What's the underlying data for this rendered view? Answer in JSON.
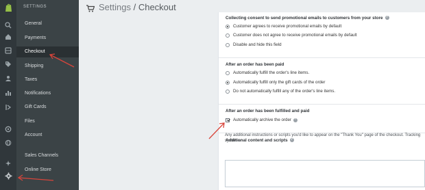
{
  "rail": {
    "icons": [
      "shopify-logo-icon",
      "search-icon",
      "home-icon",
      "orders-icon",
      "products-icon",
      "tag-icon",
      "customers-icon",
      "reports-icon",
      "discounts-icon",
      "apps-icon",
      "online-store-icon",
      "globe-icon",
      "settings-icon"
    ]
  },
  "sidebar": {
    "heading": "SETTINGS",
    "items": [
      {
        "label": "General"
      },
      {
        "label": "Payments"
      },
      {
        "label": "Checkout"
      },
      {
        "label": "Shipping"
      },
      {
        "label": "Taxes"
      },
      {
        "label": "Notifications"
      },
      {
        "label": "Gift Cards"
      },
      {
        "label": "Files"
      },
      {
        "label": "Account"
      },
      {
        "label": "Sales Channels"
      },
      {
        "label": "Online Store"
      }
    ]
  },
  "header": {
    "crumb": "Settings",
    "separator": " / ",
    "page": "Checkout"
  },
  "consent": {
    "title": "Collecting consent to send promotional emails to customers from your store",
    "options": [
      {
        "label": "Customer agrees to receive promotional emails by default",
        "selected": true
      },
      {
        "label": "Customer does not agree to receive promotional emails by default",
        "selected": false
      },
      {
        "label": "Disable and hide this field",
        "selected": false
      }
    ]
  },
  "paid": {
    "title": "After an order has been paid",
    "options": [
      {
        "label": "Automatically fulfill the order's line items.",
        "selected": false
      },
      {
        "label": "Automatically fulfill only the gift cards of the order",
        "selected": true
      },
      {
        "label": "Do not automatically fulfill any of the order's line items.",
        "selected": false
      }
    ]
  },
  "fulfilled": {
    "title": "After an order has been fulfilled and paid",
    "checkbox_label": "Automatically archive the order",
    "checked": true
  },
  "additional": {
    "title": "Additional content and scripts",
    "description": "Any additional instructions or scripts you'd like to appear on the \"Thank You\" page of the checkout. Tracking systems.",
    "textarea_value": ""
  },
  "colors": {
    "rail": "#30373b",
    "sidebar": "#3b4346",
    "active": "#2a3033",
    "annotation": "#d9453b"
  }
}
